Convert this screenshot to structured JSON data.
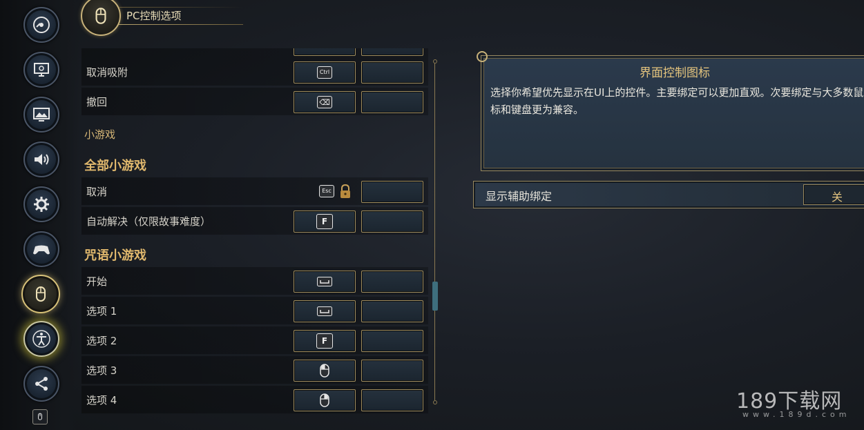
{
  "header": {
    "title": "PC控制选项"
  },
  "sidebar": {
    "items": [
      "disc-icon",
      "monitor-icon",
      "picture-icon",
      "speaker-icon",
      "gear-icon",
      "gamepad-icon",
      "mouse-icon",
      "accessibility-icon",
      "share-icon"
    ]
  },
  "bindings": {
    "undock_label": "取消吸附",
    "undock_key": "Ctrl",
    "undo_label": "撤回",
    "undo_key": "⌫",
    "minigames_sub": "小游戏",
    "all_minigames_head": "全部小游戏",
    "cancel_label": "取消",
    "cancel_key": "Esc",
    "autosolve_label": "自动解决（仅限故事难度）",
    "autosolve_key": "F",
    "spell_head": "咒语小游戏",
    "start_label": "开始",
    "opt1_label": "选项 1",
    "opt2_label": "选项 2",
    "opt2_key": "F",
    "opt3_label": "选项 3",
    "opt4_label": "选项 4"
  },
  "info": {
    "title": "界面控制图标",
    "text": "选择你希望优先显示在UI上的控件。主要绑定可以更加直观。次要绑定与大多数鼠标和键盘更为兼容。"
  },
  "toggle": {
    "label": "显示辅助绑定",
    "value": "关"
  },
  "watermark": {
    "main": "189下载网",
    "sub": "www.189d.com"
  },
  "colors": {
    "accent_gold": "#e0b86d",
    "panel": "#2b3a4c",
    "key_border": "#a08d5e"
  }
}
